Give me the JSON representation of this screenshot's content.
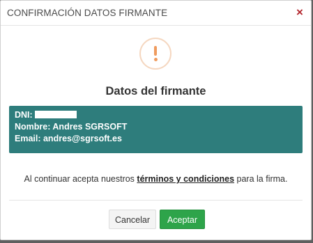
{
  "dialog": {
    "title": "CONFIRMACIÓN DATOS FIRMANTE",
    "close_label": "×"
  },
  "section": {
    "title": "Datos del firmante"
  },
  "signer": {
    "dni_label": "DNI:",
    "name_line": "Nombre: Andres SGRSOFT",
    "email_line": "Email: andres@sgrsoft.es"
  },
  "terms": {
    "prefix": "Al continuar acepta nuestros",
    "link": "términos y condiciones",
    "suffix": "para la firma."
  },
  "buttons": {
    "cancel": "Cancelar",
    "accept": "Aceptar"
  },
  "colors": {
    "info_box": "#2e7d7c",
    "accept": "#2ea44a",
    "close": "#b3262d",
    "warning": "#ef9b5e"
  },
  "icons": {
    "alert": "exclamation-circle-icon",
    "close": "close-icon"
  }
}
